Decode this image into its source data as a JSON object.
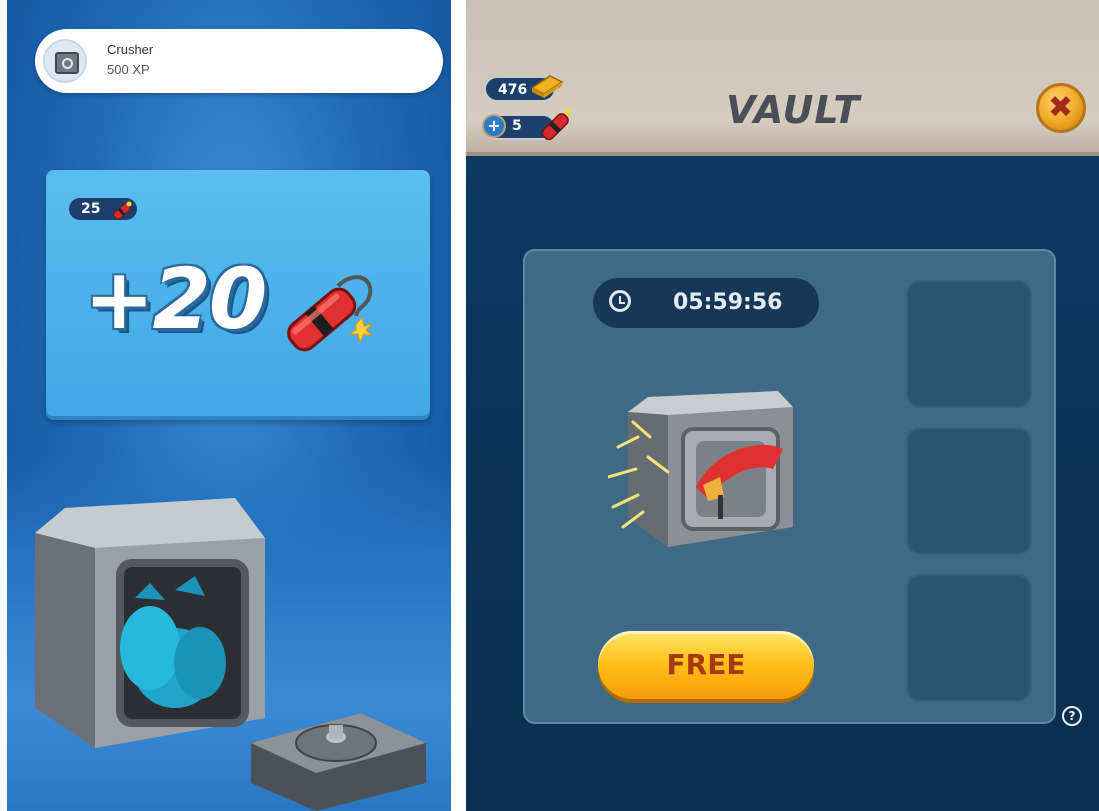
{
  "achievement": {
    "title": "Crusher",
    "subtitle": "500 XP",
    "icon": "vault-icon"
  },
  "reward_card": {
    "dynamite_count": "25",
    "reward_amount": "+20",
    "reward_icon": "dynamite-icon"
  },
  "vault_screen": {
    "title": "VAULT",
    "gold": "476",
    "dynamite": "5",
    "timer": "05:59:56",
    "free_button": "FREE",
    "help_symbol": "?",
    "slots": [
      "",
      "",
      ""
    ]
  },
  "colors": {
    "left_background": "#1f6bb7",
    "card": "#4fb3ea",
    "vault_panel": "#3f6a83",
    "free_button": "#ffc21c",
    "close_button": "#f0a726"
  }
}
